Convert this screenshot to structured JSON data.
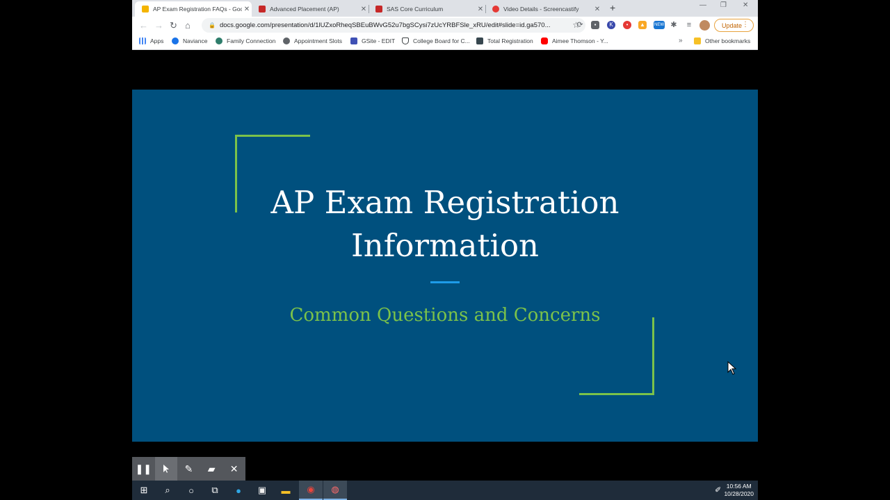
{
  "browser": {
    "tabs": [
      {
        "title": "AP Exam Registration FAQs - Goo",
        "active": true,
        "favicon_color": "#f4b400"
      },
      {
        "title": "Advanced Placement (AP)",
        "active": false,
        "favicon_color": "#c62828"
      },
      {
        "title": "SAS Core Curriculum",
        "active": false,
        "favicon_color": "#c62828"
      },
      {
        "title": "Video Details - Screencastify",
        "active": false,
        "favicon_color": "#e53935"
      }
    ],
    "new_tab_icon": "plus-icon",
    "url": "docs.google.com/presentation/d/1lUZxoRheqSBEuBWvG52u7bgSCysi7zUcYRBFSle_xRU/edit#slide=id.ga570...",
    "update_label": "Update",
    "bookmarks": [
      {
        "label": "Apps",
        "icon": "apps-grid-icon",
        "color": "#4285f4"
      },
      {
        "label": "Naviance",
        "icon": "naviance-icon",
        "color": "#1a73e8"
      },
      {
        "label": "Family Connection",
        "icon": "family-connection-icon",
        "color": "#2e7d6b"
      },
      {
        "label": "Appointment Slots",
        "icon": "globe-icon",
        "color": "#5f6368"
      },
      {
        "label": "GSite - EDIT",
        "icon": "gsite-icon",
        "color": "#3f51b5"
      },
      {
        "label": "College Board for C...",
        "icon": "shield-icon",
        "color": "#3c4043"
      },
      {
        "label": "Total Registration",
        "icon": "tr-icon",
        "color": "#37474f"
      },
      {
        "label": "Aimee Thomson - Y...",
        "icon": "youtube-icon",
        "color": "#ff0000"
      }
    ],
    "more_bookmarks": "»",
    "other_bookmarks": "Other bookmarks"
  },
  "slide": {
    "title_line1": "AP Exam Registration",
    "title_line2": "Information",
    "subtitle": "Common Questions and Concerns",
    "background_color": "#00507e",
    "accent_green": "#7bc24a",
    "accent_blue": "#1e9be8"
  },
  "recorder_toolbar": {
    "buttons": [
      "pause-icon",
      "pointer-icon",
      "pen-icon",
      "eraser-icon",
      "close-icon"
    ]
  },
  "taskbar": {
    "time": "10:56 AM",
    "date": "10/28/2020"
  }
}
